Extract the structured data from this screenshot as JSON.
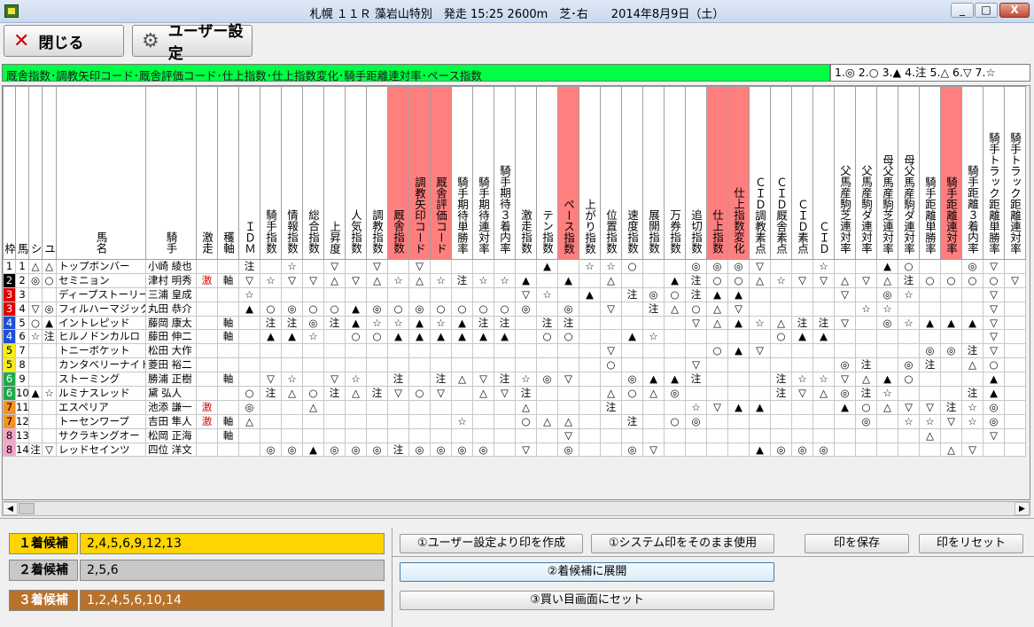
{
  "window": {
    "title": "札幌 １１Ｒ 藻岩山特別　発走 15:25 2600m　芝･右　　2014年8月9日（土）",
    "minimize": "_",
    "maximize": "□",
    "close": "X"
  },
  "toolbar": {
    "close_label": "閉じる",
    "user_settings_label": "ユーザー設定"
  },
  "index_bar": {
    "text": "厩舎指数･調教矢印コード･厩舎評価コード･仕上指数･仕上指数変化･騎手距離連対率･ペース指数",
    "legend": "1.◎ 2.○ 3.▲ 4.注 5.△ 6.▽ 7.☆"
  },
  "columns": [
    {
      "h": "枠",
      "w": 14
    },
    {
      "h": "馬",
      "w": 15
    },
    {
      "h": "シ",
      "w": 15
    },
    {
      "h": "ユ",
      "w": 16
    },
    {
      "h": "馬名",
      "w": 101
    },
    {
      "h": "騎手",
      "w": 57
    },
    {
      "h": "激走",
      "w": 24
    },
    {
      "h": "穫軸",
      "w": 24
    },
    {
      "h": "ＩＤＭ",
      "w": 24
    },
    {
      "h": "騎手指数",
      "w": 24
    },
    {
      "h": "情報指数",
      "w": 24
    },
    {
      "h": "総合指数",
      "w": 24
    },
    {
      "h": "上昇度",
      "w": 24
    },
    {
      "h": "人気指数",
      "w": 24
    },
    {
      "h": "調教指数",
      "w": 24
    },
    {
      "h": "厩舎指数",
      "w": 24,
      "pk": true
    },
    {
      "h": "調教矢印コード",
      "w": 24,
      "pk": true
    },
    {
      "h": "厩舎評価コード",
      "w": 24,
      "pk": true
    },
    {
      "h": "騎手期待単勝率",
      "w": 24
    },
    {
      "h": "騎手期待連対率",
      "w": 24
    },
    {
      "h": "騎手期待３着内率",
      "w": 24
    },
    {
      "h": "激走指数",
      "w": 24
    },
    {
      "h": "テン指数",
      "w": 24
    },
    {
      "h": "ペース指数",
      "w": 24,
      "pk": true
    },
    {
      "h": "上がり指数",
      "w": 24
    },
    {
      "h": "位置指数",
      "w": 24
    },
    {
      "h": "速度指数",
      "w": 24
    },
    {
      "h": "展開指数",
      "w": 24
    },
    {
      "h": "万券指数",
      "w": 24
    },
    {
      "h": "追切指数",
      "w": 24
    },
    {
      "h": "仕上指数",
      "w": 24,
      "pk": true
    },
    {
      "h": "仕上指数変化",
      "w": 24,
      "pk": true
    },
    {
      "h": "ＣＩＤ調教素点",
      "w": 24
    },
    {
      "h": "ＣＩＤ厩舎素点",
      "w": 24
    },
    {
      "h": "ＣＩＤ素点",
      "w": 24
    },
    {
      "h": "ＣＩＤ",
      "w": 24
    },
    {
      "h": "父馬産駒芝連対率",
      "w": 24
    },
    {
      "h": "父馬産駒ダ連対率",
      "w": 24
    },
    {
      "h": "母父馬産駒芝連対率",
      "w": 24
    },
    {
      "h": "母父馬産駒ダ連対率",
      "w": 24
    },
    {
      "h": "騎手距離単勝率",
      "w": 24
    },
    {
      "h": "騎手距離連対率",
      "w": 24,
      "pk": true
    },
    {
      "h": "騎手距離３着内率",
      "w": 24
    },
    {
      "h": "騎手トラック距離単勝率",
      "w": 24
    },
    {
      "h": "騎手トラック距離連対率",
      "w": 24
    }
  ],
  "rows": [
    {
      "w": 1,
      "c": [
        "1",
        "1",
        "△",
        "△",
        "トップボンバー",
        "小崎 綾也",
        "",
        "",
        "注",
        "",
        "☆",
        "",
        "▽",
        "",
        "▽",
        "",
        "▽",
        "",
        "",
        "",
        "",
        "",
        "▲",
        "",
        "☆",
        "☆",
        "○",
        "",
        "",
        "◎",
        "◎",
        "◎",
        "▽",
        "",
        "",
        "☆",
        "",
        "",
        "▲",
        "○",
        "",
        "",
        "◎",
        "▽",
        ""
      ]
    },
    {
      "w": 2,
      "c": [
        "2",
        "2",
        "◎",
        "○",
        "セミニョン",
        "津村 明秀",
        "激",
        "軸",
        "▽",
        "☆",
        "▽",
        "▽",
        "△",
        "▽",
        "△",
        "☆",
        "△",
        "☆",
        "注",
        "☆",
        "☆",
        "▲",
        "",
        "▲",
        "",
        "△",
        "",
        "",
        "▲",
        "注",
        "○",
        "○",
        "△",
        "☆",
        "▽",
        "▽",
        "△",
        "▽",
        "△",
        "注",
        "○",
        "○",
        "○",
        "○",
        "▽",
        ""
      ]
    },
    {
      "w": 3,
      "c": [
        "3",
        "3",
        "",
        "",
        "ディープストーリー",
        "三浦 皇成",
        "",
        "",
        "☆",
        "",
        "",
        "",
        "",
        "",
        "",
        "",
        "",
        "",
        "",
        "",
        "",
        "▽",
        "☆",
        "",
        "▲",
        "",
        "注",
        "◎",
        "○",
        "注",
        "▲",
        "▲",
        "",
        "",
        "",
        "",
        "▽",
        "",
        "◎",
        "☆",
        "",
        "",
        "",
        "▽",
        ""
      ]
    },
    {
      "w": 3,
      "c": [
        "3",
        "4",
        "▽",
        "◎",
        "フィルハーマジック",
        "丸田 恭介",
        "",
        "",
        "▲",
        "○",
        "◎",
        "○",
        "○",
        "▲",
        "◎",
        "○",
        "◎",
        "○",
        "○",
        "○",
        "○",
        "◎",
        "",
        "◎",
        "",
        "▽",
        "",
        "注",
        "△",
        "○",
        "△",
        "▽",
        "",
        "",
        "",
        "",
        "",
        "☆",
        "☆",
        "",
        "",
        "",
        "",
        "▽",
        ""
      ]
    },
    {
      "w": 4,
      "c": [
        "4",
        "5",
        "○",
        "▲",
        "イントレピッド",
        "藤岡 康太",
        "",
        "軸",
        "",
        "注",
        "注",
        "◎",
        "注",
        "▲",
        "☆",
        "☆",
        "▲",
        "☆",
        "▲",
        "注",
        "注",
        "",
        "注",
        "注",
        "",
        "",
        "",
        "",
        "",
        "▽",
        "△",
        "▲",
        "☆",
        "△",
        "注",
        "注",
        "▽",
        "",
        "◎",
        "☆",
        "▲",
        "▲",
        "▲",
        "▽",
        ""
      ]
    },
    {
      "w": 4,
      "c": [
        "4",
        "6",
        "☆",
        "注",
        "ヒルノドンカルロ",
        "藤田 伸二",
        "",
        "軸",
        "",
        "▲",
        "▲",
        "☆",
        "",
        "○",
        "○",
        "▲",
        "▲",
        "▲",
        "▲",
        "▲",
        "▲",
        "",
        "○",
        "○",
        "",
        "",
        "▲",
        "☆",
        "",
        "",
        "",
        "",
        "",
        "○",
        "▲",
        "▲",
        "",
        "",
        "",
        "",
        "",
        "",
        "",
        "▽",
        ""
      ]
    },
    {
      "w": 5,
      "c": [
        "5",
        "7",
        "",
        "",
        "トニーボケット",
        "松田 大作",
        "",
        "",
        "",
        "",
        "",
        "",
        "",
        "",
        "",
        "",
        "",
        "",
        "",
        "",
        "",
        "",
        "",
        "",
        "",
        "▽",
        "",
        "",
        "",
        "",
        "○",
        "▲",
        "▽",
        "",
        "",
        "",
        "",
        "",
        "",
        "",
        "◎",
        "◎",
        "注",
        "▽",
        ""
      ]
    },
    {
      "w": 5,
      "c": [
        "5",
        "8",
        "",
        "",
        "カンタベリーナイト",
        "菱田 裕二",
        "",
        "",
        "",
        "",
        "",
        "",
        "",
        "",
        "",
        "",
        "",
        "",
        "",
        "",
        "",
        "",
        "",
        "",
        "",
        "○",
        "",
        "",
        "",
        "▽",
        "",
        "",
        "",
        "",
        "",
        "",
        "◎",
        "注",
        "",
        "◎",
        "注",
        "",
        "△",
        "○",
        ""
      ]
    },
    {
      "w": 6,
      "c": [
        "6",
        "9",
        "",
        "",
        "ストーミング",
        "勝浦 正樹",
        "",
        "軸",
        "",
        "▽",
        "☆",
        "",
        "▽",
        "☆",
        "",
        "注",
        "",
        "注",
        "△",
        "▽",
        "注",
        "☆",
        "◎",
        "▽",
        "",
        "",
        "◎",
        "▲",
        "▲",
        "注",
        "",
        "",
        "",
        "注",
        "☆",
        "☆",
        "▽",
        "△",
        "▲",
        "○",
        "",
        "",
        "",
        "▲",
        ""
      ]
    },
    {
      "w": 6,
      "c": [
        "6",
        "10",
        "▲",
        "☆",
        "ルミナスレッド",
        "黛 弘人",
        "",
        "",
        "○",
        "注",
        "△",
        "○",
        "注",
        "△",
        "注",
        "▽",
        "○",
        "▽",
        "",
        "△",
        "▽",
        "注",
        "",
        "",
        "",
        "△",
        "○",
        "△",
        "◎",
        "",
        "",
        "",
        "",
        "注",
        "▽",
        "△",
        "◎",
        "注",
        "☆",
        "",
        "",
        "",
        "注",
        "▲",
        ""
      ]
    },
    {
      "w": 7,
      "c": [
        "7",
        "11",
        "",
        "",
        "エスペリア",
        "池添 謙一",
        "激",
        "",
        "◎",
        "",
        "",
        "△",
        "",
        "",
        "",
        "",
        "",
        "",
        "",
        "",
        "",
        "△",
        "",
        "",
        "",
        "注",
        "",
        "",
        "",
        "☆",
        "▽",
        "▲",
        "▲",
        "",
        "",
        "",
        "▲",
        "○",
        "△",
        "▽",
        "▽",
        "注",
        "☆",
        "◎",
        ""
      ]
    },
    {
      "w": 7,
      "c": [
        "7",
        "12",
        "",
        "",
        "トーセンワープ",
        "吉田 隼人",
        "激",
        "軸",
        "△",
        "",
        "",
        "",
        "",
        "",
        "",
        "",
        "",
        "",
        "☆",
        "",
        "",
        "○",
        "△",
        "△",
        "",
        "",
        "注",
        "",
        "○",
        "◎",
        "",
        "",
        "",
        "",
        "",
        "",
        "",
        "◎",
        "",
        "☆",
        "☆",
        "▽",
        "☆",
        "◎",
        ""
      ]
    },
    {
      "w": 8,
      "c": [
        "8",
        "13",
        "",
        "",
        "サクラキングオー",
        "松岡 正海",
        "",
        "軸",
        "",
        "",
        "",
        "",
        "",
        "",
        "",
        "",
        "",
        "",
        "",
        "",
        "",
        "",
        "",
        "▽",
        "",
        "",
        "",
        "",
        "",
        "",
        "",
        "",
        "",
        "",
        "",
        "",
        "",
        "",
        "",
        "",
        "△",
        "",
        "",
        "▽",
        ""
      ]
    },
    {
      "w": 8,
      "c": [
        "8",
        "14",
        "注",
        "▽",
        "レッドセインツ",
        "四位 洋文",
        "",
        "",
        "",
        "◎",
        "◎",
        "▲",
        "◎",
        "◎",
        "◎",
        "注",
        "◎",
        "◎",
        "◎",
        "◎",
        "",
        "▽",
        "",
        "◎",
        "",
        "",
        "◎",
        "▽",
        "",
        "",
        "",
        "",
        "▲",
        "◎",
        "◎",
        "◎",
        "",
        "",
        "",
        "",
        "",
        "△",
        "▽",
        "",
        ""
      ]
    }
  ],
  "scroll": {
    "left": "◀",
    "right": "▶"
  },
  "candidates": [
    {
      "label": "１着候補",
      "value": "2,4,5,6,9,12,13"
    },
    {
      "label": "２着候補",
      "value": "2,5,6"
    },
    {
      "label": "３着候補",
      "value": "1,2,4,5,6,10,14"
    }
  ],
  "buttons": {
    "user_mark": "①ユーザー設定より印を作成",
    "system_mark": "①システム印をそのまま使用",
    "save_mark": "印を保存",
    "reset_mark": "印をリセット",
    "expand": "②着候補に展開",
    "set_bet": "③買い目画面にセット"
  }
}
